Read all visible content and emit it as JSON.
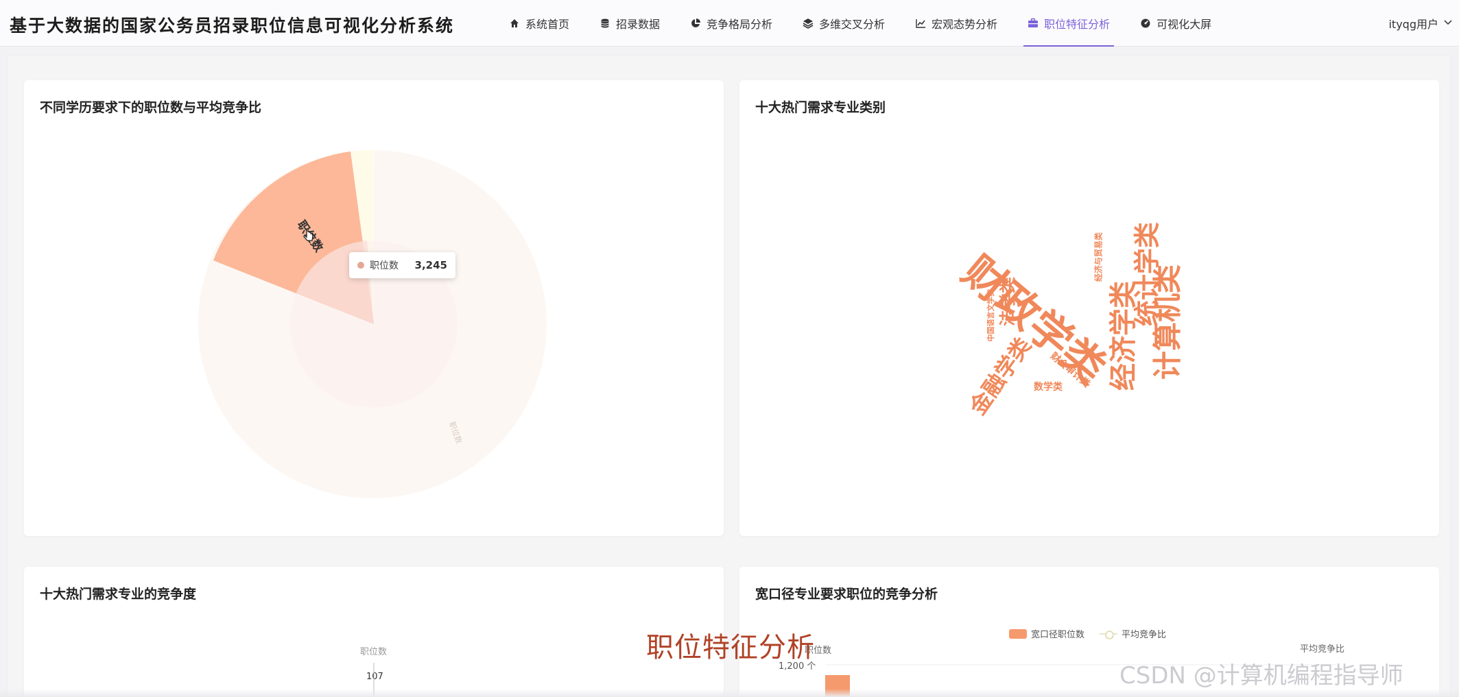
{
  "app": {
    "title": "基于大数据的国家公务员招录职位信息可视化分析系统"
  },
  "nav": [
    {
      "label": "系统首页",
      "icon": "home-icon",
      "active": false
    },
    {
      "label": "招录数据",
      "icon": "database-icon",
      "active": false
    },
    {
      "label": "竞争格局分析",
      "icon": "pie-chart-icon",
      "active": false
    },
    {
      "label": "多维交叉分析",
      "icon": "layers-icon",
      "active": false
    },
    {
      "label": "宏观态势分析",
      "icon": "line-chart-icon",
      "active": false
    },
    {
      "label": "职位特征分析",
      "icon": "briefcase-icon",
      "active": true
    },
    {
      "label": "可视化大屏",
      "icon": "dashboard-icon",
      "active": false
    }
  ],
  "user": {
    "label": "ityqg用户"
  },
  "cards": {
    "education": {
      "title": "不同学历要求下的职位数与平均竞争比"
    },
    "majors": {
      "title": "十大热门需求专业类别"
    },
    "competition": {
      "title": "十大热门需求专业的竞争度"
    },
    "broad": {
      "title": "宽口径专业要求职位的竞争分析"
    }
  },
  "chart_data": [
    {
      "type": "pie",
      "title": "不同学历要求下的职位数与平均竞争比",
      "tooltip": {
        "series": "职位数",
        "value": "3,245"
      },
      "labels": [
        "职位数",
        "职位数"
      ],
      "colors": {
        "highlight": "#fcb898",
        "muted": "#fdf7f3",
        "inner": "#fbeae5"
      }
    },
    {
      "type": "wordcloud",
      "title": "十大热门需求专业类别",
      "words": [
        "财政学类",
        "计算机类",
        "经济学类",
        "统计学类",
        "金融学类",
        "法学类",
        "中国语言文学类",
        "经济与贸易类",
        "财会审计类",
        "数学类"
      ],
      "color": "#f0885a"
    },
    {
      "type": "bar",
      "title": "十大热门需求专业的竞争度",
      "ylabel": "职位数",
      "value_label": "107"
    },
    {
      "type": "bar",
      "title": "宽口径专业要求职位的竞争分析",
      "series": [
        {
          "name": "宽口径职位数",
          "color": "#f59a6c"
        },
        {
          "name": "平均竞争比",
          "color": "#e3dfb8"
        }
      ],
      "ylabel": "职位数",
      "y2label": "平均竞争比",
      "ytick_top": "1,200 个"
    }
  ],
  "overlay": {
    "caption": "职位特征分析",
    "watermark": "CSDN @计算机编程指导师"
  }
}
